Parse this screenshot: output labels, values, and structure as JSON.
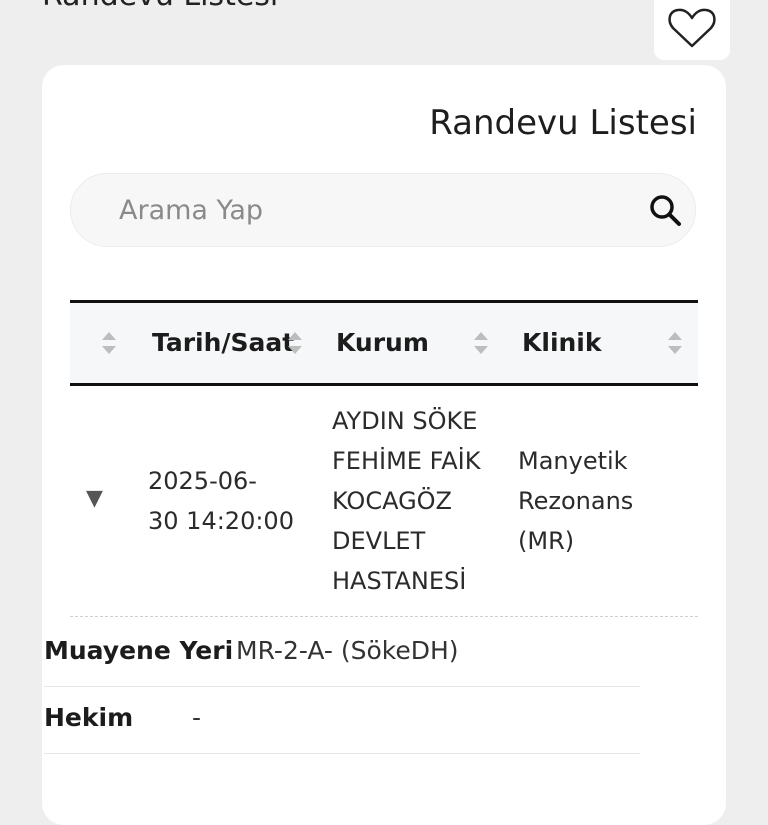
{
  "header": {
    "title": "Randevu Listesi"
  },
  "card": {
    "title": "Randevu Listesi"
  },
  "search": {
    "placeholder": "Arama Yap",
    "value": ""
  },
  "table": {
    "columns": [
      "",
      "Tarih/Saat",
      "Kurum",
      "Klinik"
    ],
    "rows": [
      {
        "datetime": "2025-06-30 14:20:00",
        "datetime_lines": [
          "2025-06-",
          "30 14:20:00"
        ],
        "institution_lines": [
          "AYDIN SÖKE",
          "FEHİME FAİK",
          "KOCAGÖZ",
          "DEVLET",
          "HASTANESİ"
        ],
        "clinic_lines": [
          "Manyetik",
          "Rezonans",
          "(MR)"
        ]
      }
    ]
  },
  "details": [
    {
      "label": "Muayene Yeri",
      "value": "MR-2-A- (SökeDH)"
    },
    {
      "label": "Hekim",
      "value": "-"
    }
  ],
  "icons": {
    "favorite": "heart-icon",
    "search": "search-icon",
    "sort": "sort-icon",
    "expand": "triangle-down-icon"
  },
  "colors": {
    "background": "#eeeeee",
    "card": "#ffffff",
    "header_bg": "#f6f7f9",
    "border_dark": "#111111"
  }
}
